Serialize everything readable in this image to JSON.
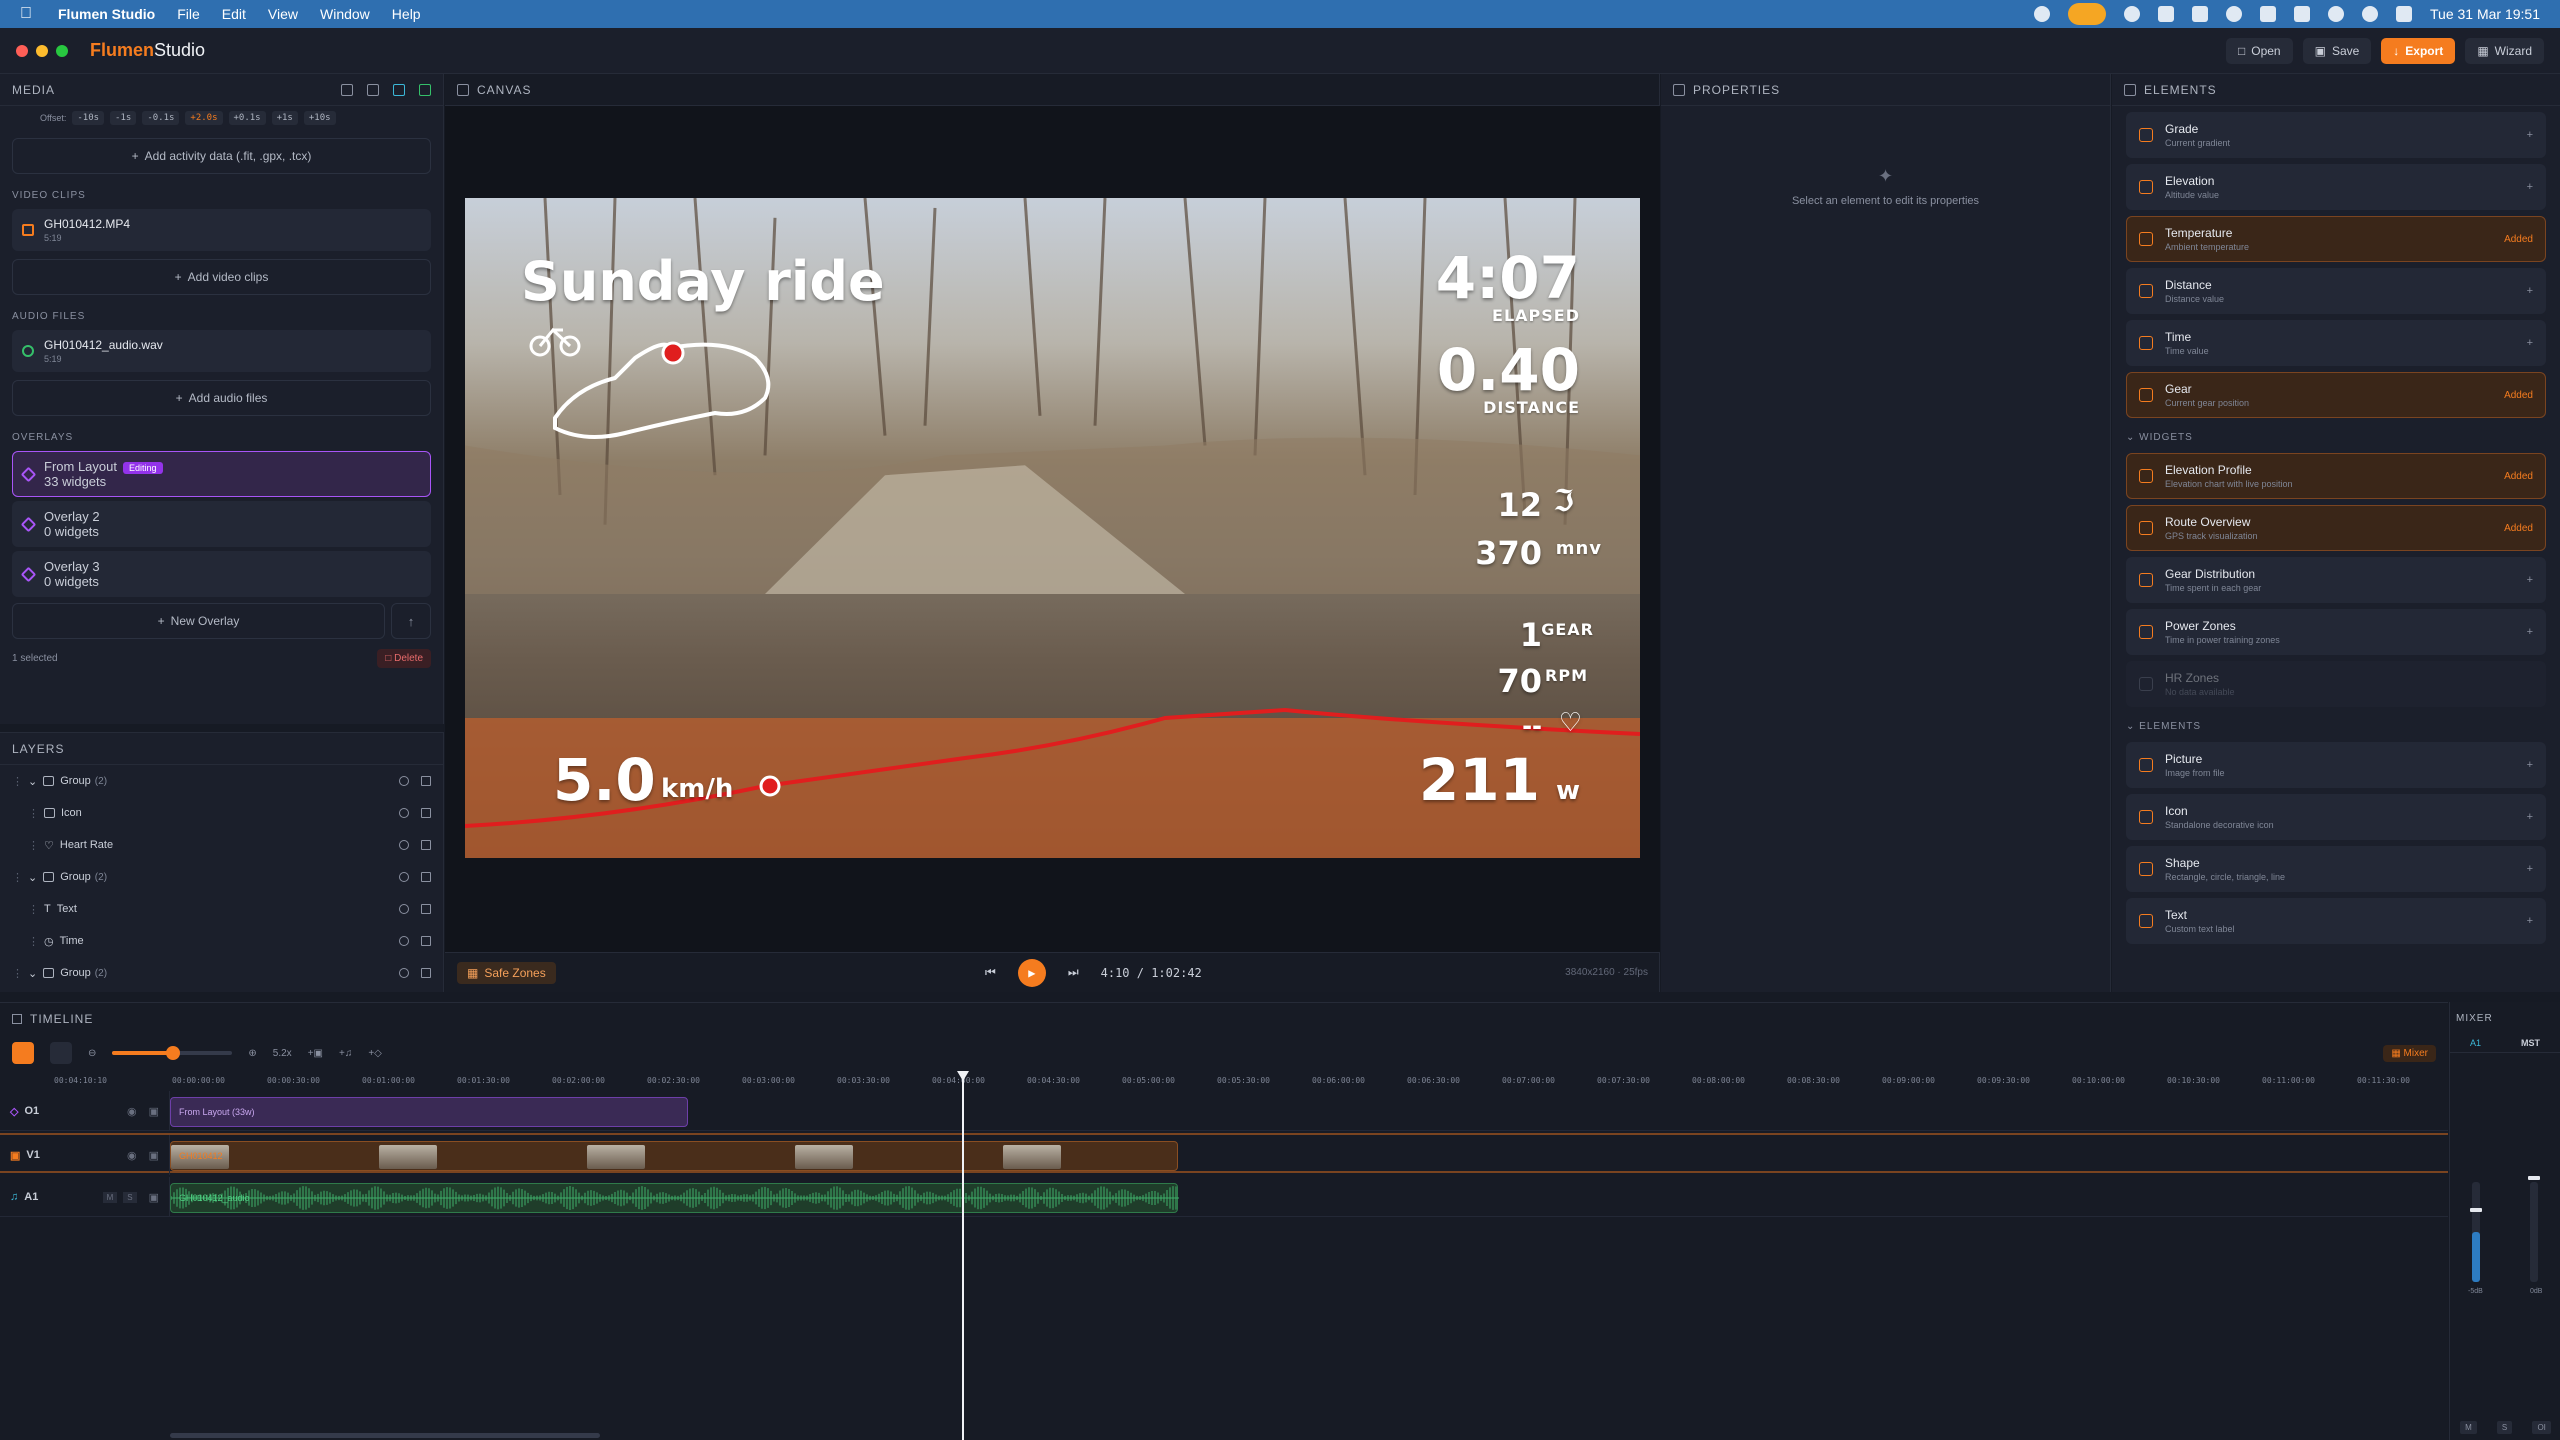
{
  "menubar": {
    "app_name": "Flumen Studio",
    "menus": [
      "File",
      "Edit",
      "View",
      "Window",
      "Help"
    ],
    "clock": "Tue 31 Mar  19:51"
  },
  "titlebar": {
    "brand_1": "Flumen",
    "brand_2": "Studio",
    "open": "Open",
    "save": "Save",
    "export": "Export",
    "wizard": "Wizard"
  },
  "media": {
    "title": "MEDIA",
    "offset_label": "Offset:",
    "offsets": [
      "-10s",
      "-1s",
      "-0.1s",
      "+2.0s",
      "+0.1s",
      "+1s",
      "+10s"
    ],
    "add_activity": "Add activity data (.fit, .gpx, .tcx)",
    "video_section": "VIDEO CLIPS",
    "video_file": {
      "name": "GH010412.MP4",
      "duration": "5:19"
    },
    "add_video": "Add video clips",
    "audio_section": "AUDIO FILES",
    "audio_file": {
      "name": "GH010412_audio.wav",
      "duration": "5:19"
    },
    "add_audio": "Add audio files",
    "overlays_section": "OVERLAYS",
    "overlays": [
      {
        "name": "From Layout",
        "sub": "33 widgets",
        "badge": "Editing"
      },
      {
        "name": "Overlay 2",
        "sub": "0 widgets"
      },
      {
        "name": "Overlay 3",
        "sub": "0 widgets"
      }
    ],
    "new_overlay": "New Overlay",
    "selected": "1 selected",
    "delete": "Delete"
  },
  "layers": {
    "title": "LAYERS",
    "rows": [
      {
        "name": "Group",
        "count": "(2)"
      },
      {
        "name": "Icon"
      },
      {
        "name": "Heart Rate"
      },
      {
        "name": "Group",
        "count": "(2)"
      },
      {
        "name": "Text"
      },
      {
        "name": "Time"
      },
      {
        "name": "Group",
        "count": "(2)"
      }
    ]
  },
  "canvas": {
    "title": "CANVAS",
    "overlay": {
      "title": "Sunday ride",
      "elapsed_value": "4:07",
      "elapsed_label": "ELAPSED",
      "distance_value": "0.40",
      "distance_label": "DISTANCE",
      "temp_value": "12",
      "elevation_value": "370",
      "elevation_unit": "mnv",
      "gear_value": "1",
      "gear_label": "GEAR",
      "cadence_value": "70",
      "cadence_label": "RPM",
      "hr_value": "--",
      "speed_value": "5.0",
      "speed_unit": "km/h",
      "power_value": "211",
      "power_unit": "w"
    },
    "safe_zones": "Safe Zones",
    "time": "4:10  /  1:02:42",
    "resolution": "3840x2160 · 25fps"
  },
  "properties": {
    "title": "PROPERTIES",
    "empty": "Select an element to edit its properties"
  },
  "elements": {
    "title": "ELEMENTS",
    "data_items": [
      {
        "name": "Grade",
        "sub": "Current gradient",
        "status": "+"
      },
      {
        "name": "Elevation",
        "sub": "Altitude value",
        "status": "+"
      },
      {
        "name": "Temperature",
        "sub": "Ambient temperature",
        "status": "Added"
      },
      {
        "name": "Distance",
        "sub": "Distance value",
        "status": "+"
      },
      {
        "name": "Time",
        "sub": "Time value",
        "status": "+"
      },
      {
        "name": "Gear",
        "sub": "Current gear position",
        "status": "Added"
      }
    ],
    "widgets_section": "WIDGETS",
    "widgets": [
      {
        "name": "Elevation Profile",
        "sub": "Elevation chart with live position",
        "status": "Added"
      },
      {
        "name": "Route Overview",
        "sub": "GPS track visualization",
        "status": "Added"
      },
      {
        "name": "Gear Distribution",
        "sub": "Time spent in each gear",
        "status": "+"
      },
      {
        "name": "Power Zones",
        "sub": "Time in power training zones",
        "status": "+"
      },
      {
        "name": "HR Zones",
        "sub": "No data available",
        "status": ""
      }
    ],
    "elements_section": "ELEMENTS",
    "elements": [
      {
        "name": "Picture",
        "sub": "Image from file",
        "status": "+"
      },
      {
        "name": "Icon",
        "sub": "Standalone decorative icon",
        "status": "+"
      },
      {
        "name": "Shape",
        "sub": "Rectangle, circle, triangle, line",
        "status": "+"
      },
      {
        "name": "Text",
        "sub": "Custom text label",
        "status": "+"
      }
    ]
  },
  "timeline": {
    "title": "TIMELINE",
    "zoom": "5.2x",
    "mixer_btn": "Mixer",
    "current_time": "00:04:10:10",
    "ticks": [
      "00:00:00:00",
      "00:00:30:00",
      "00:01:00:00",
      "00:01:30:00",
      "00:02:00:00",
      "00:02:30:00",
      "00:03:00:00",
      "00:03:30:00",
      "00:04:00:00",
      "00:04:30:00",
      "00:05:00:00",
      "00:05:30:00",
      "00:06:00:00",
      "00:06:30:00",
      "00:07:00:00",
      "00:07:30:00",
      "00:08:00:00",
      "00:08:30:00",
      "00:09:00:00",
      "00:09:30:00",
      "00:10:00:00",
      "00:10:30:00",
      "00:11:00:00",
      "00:11:30:00"
    ],
    "tracks": [
      {
        "label": "O1",
        "clip": "From Layout (33w)"
      },
      {
        "label": "V1",
        "clip": "GH010412"
      },
      {
        "label": "A1",
        "clip": "GH010412_audio"
      }
    ]
  },
  "mixer": {
    "title": "MIXER",
    "tab_a1": "A1",
    "tab_mst": "MST",
    "db_a1": "-5dB",
    "db_mst": "0dB",
    "foot": [
      "M",
      "S",
      "OI"
    ]
  }
}
